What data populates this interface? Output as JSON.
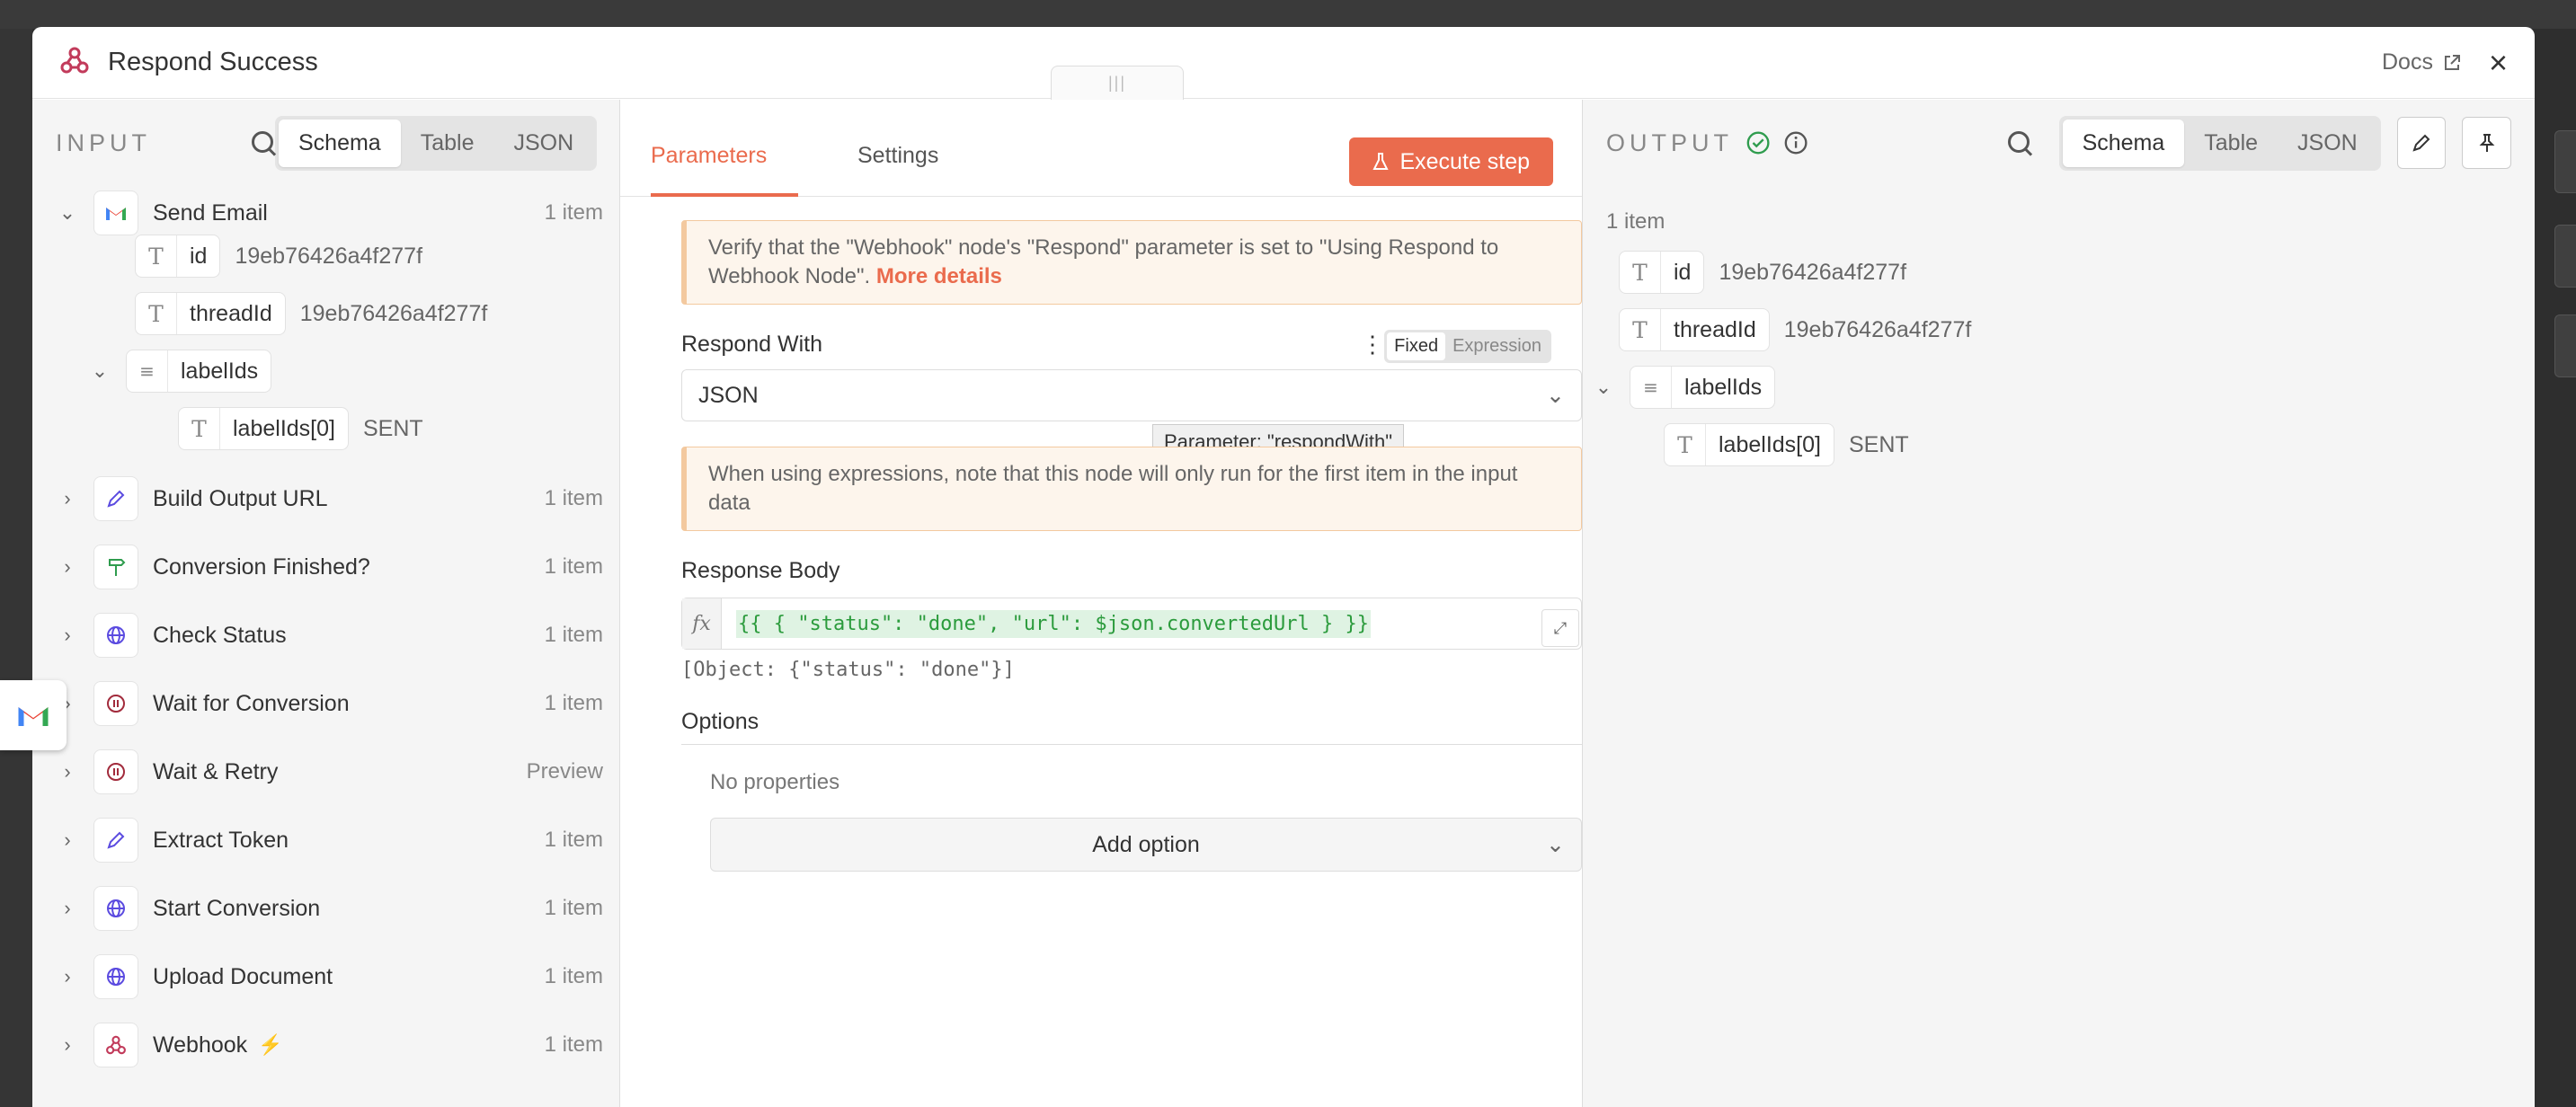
{
  "modal": {
    "title": "Respond Success",
    "docs_label": "Docs"
  },
  "input_panel": {
    "label": "INPUT",
    "view_tabs": [
      "Schema",
      "Table",
      "JSON"
    ],
    "active_tab": "Schema",
    "nodes": [
      {
        "name": "Send Email",
        "count": "1 item",
        "icon": "gmail-icon",
        "expanded": true
      },
      {
        "name": "Build Output URL",
        "count": "1 item",
        "icon": "pencil-icon"
      },
      {
        "name": "Conversion Finished?",
        "count": "1 item",
        "icon": "signpost-icon"
      },
      {
        "name": "Check Status",
        "count": "1 item",
        "icon": "globe-icon"
      },
      {
        "name": "Wait for Conversion",
        "count": "1 item",
        "icon": "pause-icon"
      },
      {
        "name": "Wait & Retry",
        "count": "Preview",
        "icon": "pause-icon"
      },
      {
        "name": "Extract Token",
        "count": "1 item",
        "icon": "pencil-icon"
      },
      {
        "name": "Start Conversion",
        "count": "1 item",
        "icon": "globe-icon"
      },
      {
        "name": "Upload Document",
        "count": "1 item",
        "icon": "globe-icon"
      },
      {
        "name": "Webhook",
        "count": "1 item",
        "icon": "webhook-icon",
        "trigger": true
      }
    ],
    "send_email_fields": [
      {
        "name": "id",
        "type": "T",
        "value": "19eb76426a4f277f"
      },
      {
        "name": "threadId",
        "type": "T",
        "value": "19eb76426a4f277f"
      },
      {
        "name": "labelIds",
        "type": "list",
        "value": ""
      },
      {
        "name": "labelIds[0]",
        "type": "T",
        "value": "SENT"
      }
    ]
  },
  "params_panel": {
    "tabs": [
      "Parameters",
      "Settings"
    ],
    "active_tab": "Parameters",
    "execute_label": "Execute step",
    "warning_text": "Verify that the \"Webhook\" node's \"Respond\" parameter is set to \"Using Respond to Webhook Node\". ",
    "warning_link": "More details",
    "respond_with_label": "Respond With",
    "mode_options": [
      "Fixed",
      "Expression"
    ],
    "mode_active": "Fixed",
    "respond_with_value": "JSON",
    "tooltip": "Parameter: \"respondWith\"",
    "expression_note": "When using expressions, note that this node will only run for the first item in the input data",
    "response_body_label": "Response Body",
    "fx_label": "fx",
    "response_body_expr": "{{ { \"status\": \"done\", \"url\": $json.convertedUrl } }}",
    "response_body_result": "[Object: {\"status\": \"done\"}]",
    "options_label": "Options",
    "no_properties": "No properties",
    "add_option_label": "Add option"
  },
  "output_panel": {
    "label": "OUTPUT",
    "view_tabs": [
      "Schema",
      "Table",
      "JSON"
    ],
    "active_tab": "Schema",
    "item_count": "1 item",
    "fields": [
      {
        "name": "id",
        "type": "T",
        "value": "19eb76426a4f277f"
      },
      {
        "name": "threadId",
        "type": "T",
        "value": "19eb76426a4f277f"
      },
      {
        "name": "labelIds",
        "type": "list",
        "value": ""
      },
      {
        "name": "labelIds[0]",
        "type": "T",
        "value": "SENT"
      }
    ]
  },
  "colors": {
    "accent": "#ea6b4d",
    "success": "#2f9c4e",
    "expression_green": "#2b9b3c"
  }
}
